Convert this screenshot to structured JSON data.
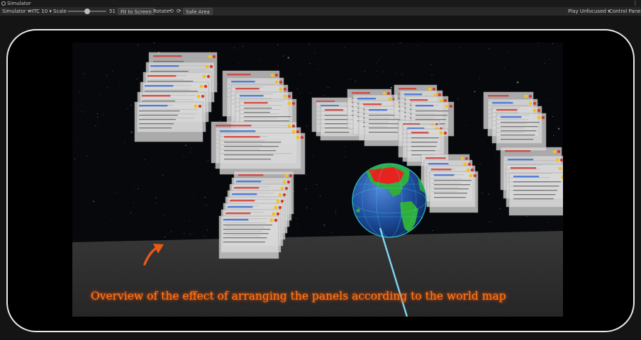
{
  "window": {
    "title": "Simulator"
  },
  "toolbar": {
    "mode_select": "Simulator",
    "device_select": "HTC 10",
    "scale_label": "Scale",
    "scale_value": "51",
    "scale_level": 0.51,
    "fit_button": "Fit to Screen",
    "rotate_label": "Rotate",
    "safe_area_button": "Safe Area",
    "play_focus_select": "Play Unfocused",
    "control_panel_button": "Control Panel"
  },
  "icons": {
    "simulator_tab": "device-icon",
    "rotate_left": "rotate-left-icon",
    "rotate_right": "rotate-right-icon",
    "menu": "kebab-menu-icon"
  },
  "game": {
    "caption": "Overview of the effect of arranging the panels according to the world map"
  },
  "colors": {
    "caption": "#ff7a1a",
    "arrow": "#e85a18",
    "laser": "#7fd6f2",
    "globe_ocean": "#1f4f9e",
    "globe_land": "#2fae3a",
    "globe_highlight": "#e6231f",
    "panel": "#d9d9d9"
  }
}
